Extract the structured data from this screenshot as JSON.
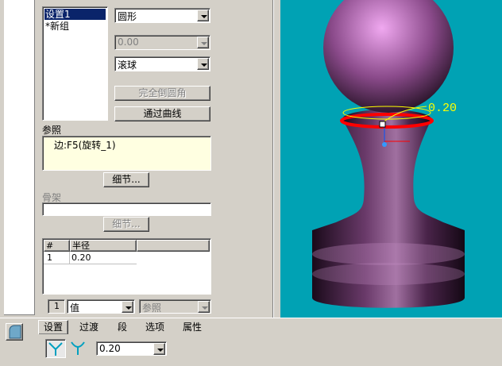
{
  "sets_list": {
    "items": [
      "设置1",
      "*新组"
    ]
  },
  "shape_combo": {
    "value": "圆形"
  },
  "value_combo": {
    "value": "0.00"
  },
  "method_combo": {
    "value": "滚球"
  },
  "buttons": {
    "full_round": "完全倒圆角",
    "through_curve": "通过曲线",
    "details_ref": "细节...",
    "details_spine": "细节..."
  },
  "references": {
    "label": "参照",
    "item": "边:F5(旋转_1)"
  },
  "spine": {
    "label": "骨架"
  },
  "radius_table": {
    "headers": [
      "#",
      "半径"
    ],
    "rows": [
      [
        "1",
        "0.20"
      ]
    ]
  },
  "radius_row_controls": {
    "index": "1",
    "mode": "值",
    "ref": "参照"
  },
  "tabs": [
    "设置",
    "过渡",
    "段",
    "选项",
    "属性"
  ],
  "dashboard": {
    "radius_value": "0.20"
  },
  "viewport": {
    "dimension_label": "0.20",
    "bg": "#00a2b4"
  }
}
